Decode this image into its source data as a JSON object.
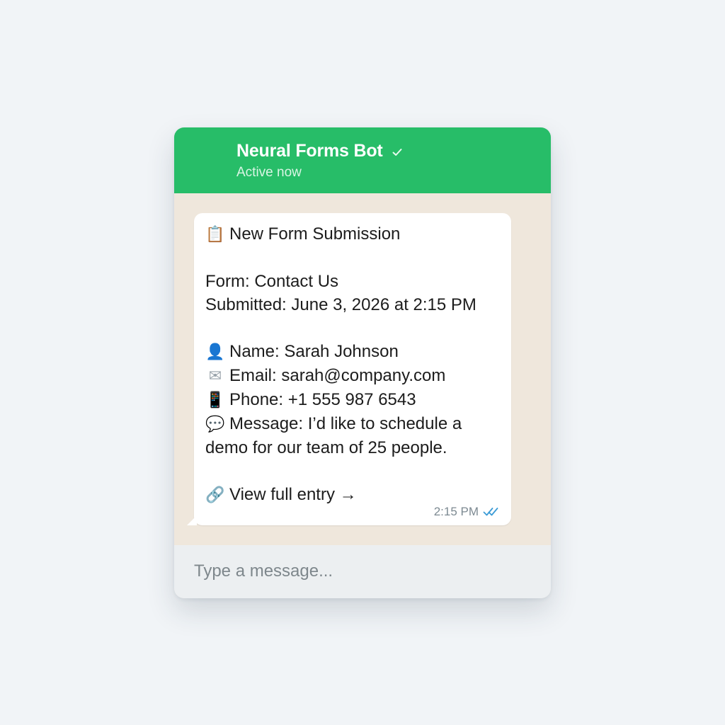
{
  "header": {
    "bot_name": "Neural Forms Bot",
    "status": "Active now",
    "verified_icon": "checkmark-icon",
    "accent_color": "#27bd68"
  },
  "message": {
    "title": "New Form Submission",
    "title_icon": "clipboard-icon",
    "form_line": "Form: Contact Us",
    "submitted_line": "Submitted: June 3, 2026 at 2:15 PM",
    "name_line": "Name: Sarah Johnson",
    "name_icon": "person-icon",
    "email_line": "Email: sarah@company.com",
    "email_icon": "envelope-icon",
    "phone_line": "Phone: +1 555 987 6543",
    "phone_icon": "phone-icon",
    "message_line_1": "Message: I’d like to schedule a",
    "message_line_2": "demo for our team of 25 people.",
    "message_icon": "speech-bubble-icon",
    "link_text": "View full entry →",
    "link_icon": "link-icon",
    "time": "2:15 PM",
    "read_icon": "double-check-icon",
    "read_color": "#3b9bd6"
  },
  "composer": {
    "placeholder": "Type a message..."
  }
}
